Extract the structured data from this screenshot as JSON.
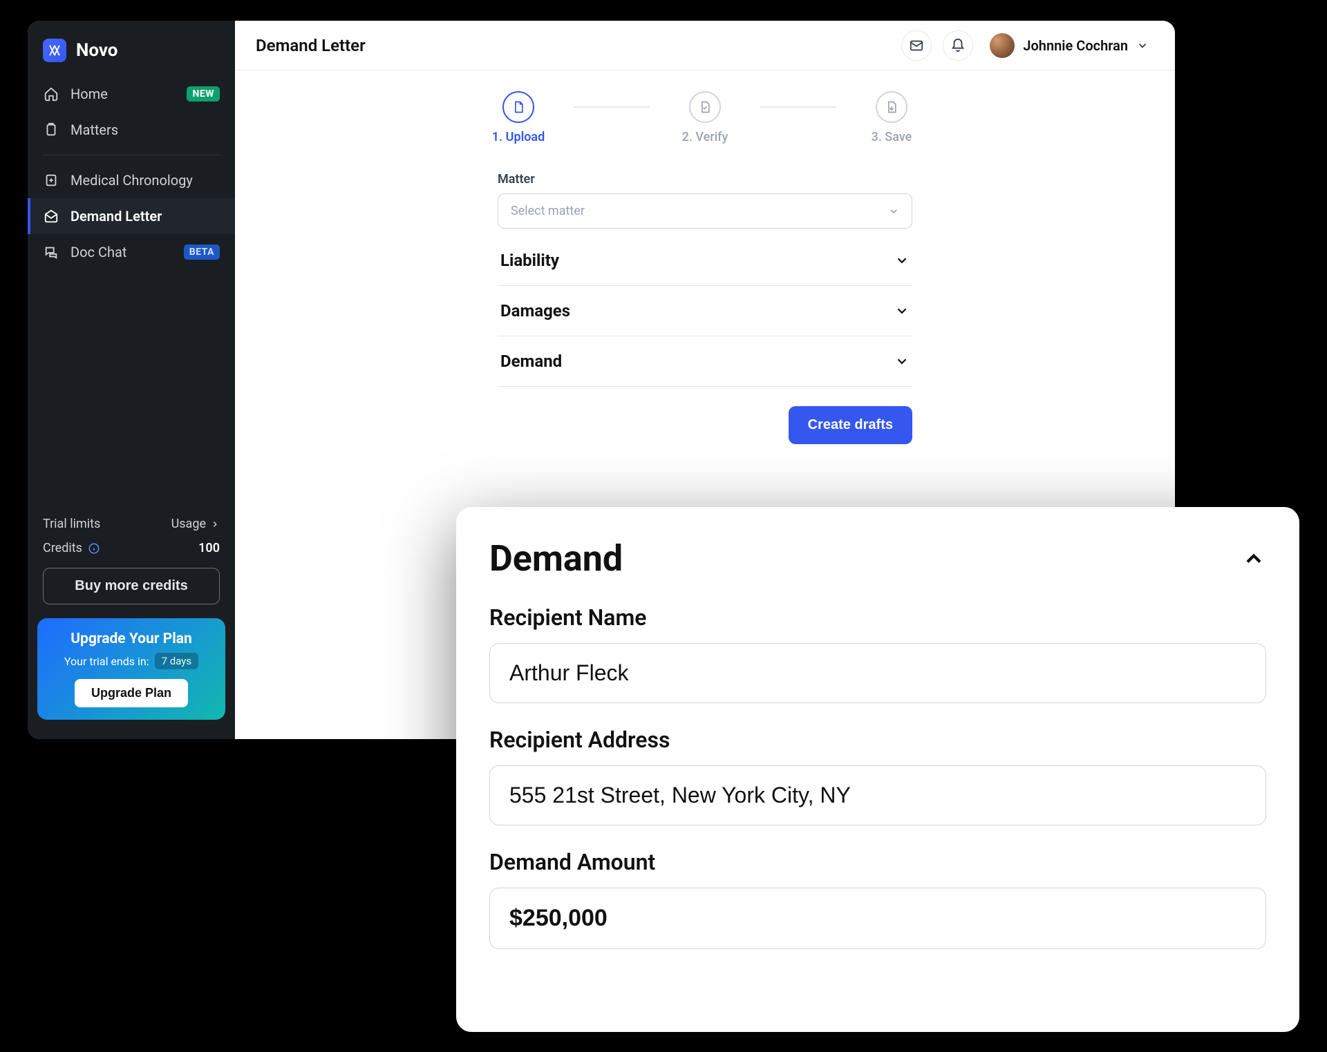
{
  "brand": {
    "name": "Novo"
  },
  "sidebar": {
    "items": [
      {
        "label": "Home",
        "badge": "NEW"
      },
      {
        "label": "Matters"
      },
      {
        "label": "Medical Chronology"
      },
      {
        "label": "Demand Letter"
      },
      {
        "label": "Doc Chat",
        "badge": "BETA"
      }
    ],
    "trial_limits_label": "Trial limits",
    "usage_label": "Usage",
    "credits_label": "Credits",
    "credits_value": "100",
    "buy_credits_label": "Buy more credits",
    "upgrade": {
      "title": "Upgrade Your Plan",
      "subtitle": "Your trial ends in:",
      "pill": "7 days",
      "button": "Upgrade Plan"
    }
  },
  "header": {
    "page_title": "Demand Letter",
    "user_name": "Johnnie Cochran"
  },
  "stepper": [
    {
      "label": "1. Upload"
    },
    {
      "label": "2. Verify"
    },
    {
      "label": "3. Save"
    }
  ],
  "form": {
    "matter_label": "Matter",
    "matter_placeholder": "Select matter",
    "sections": [
      {
        "title": "Liability"
      },
      {
        "title": "Damages"
      },
      {
        "title": "Demand"
      }
    ],
    "create_button": "Create drafts"
  },
  "demand_panel": {
    "title": "Demand",
    "recipient_name_label": "Recipient Name",
    "recipient_name_value": "Arthur Fleck",
    "recipient_address_label": "Recipient Address",
    "recipient_address_value": "555 21st Street, New York City, NY",
    "demand_amount_label": "Demand Amount",
    "demand_amount_value": "$250,000"
  }
}
